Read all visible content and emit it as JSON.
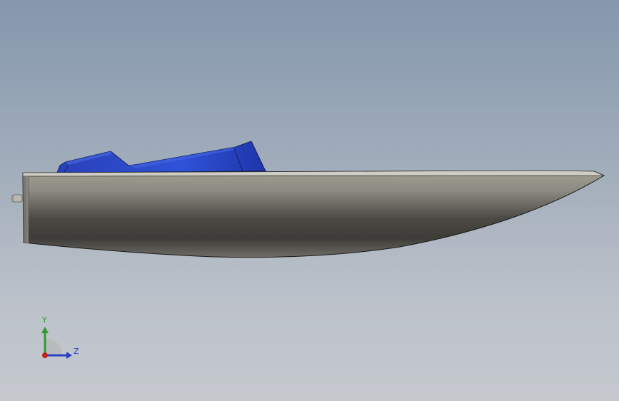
{
  "viewport": {
    "background_top": "#8497ad",
    "background_bottom": "#c5c9ce"
  },
  "model": {
    "name": "speedboat-hull",
    "hull_color": "#8a887e",
    "deck_color": "#2b48c8"
  },
  "triad": {
    "y_label": "Y",
    "z_label": "Z",
    "y_color": "#2f9a2f",
    "z_color": "#2a3fc4",
    "origin_color": "#c8201e"
  }
}
